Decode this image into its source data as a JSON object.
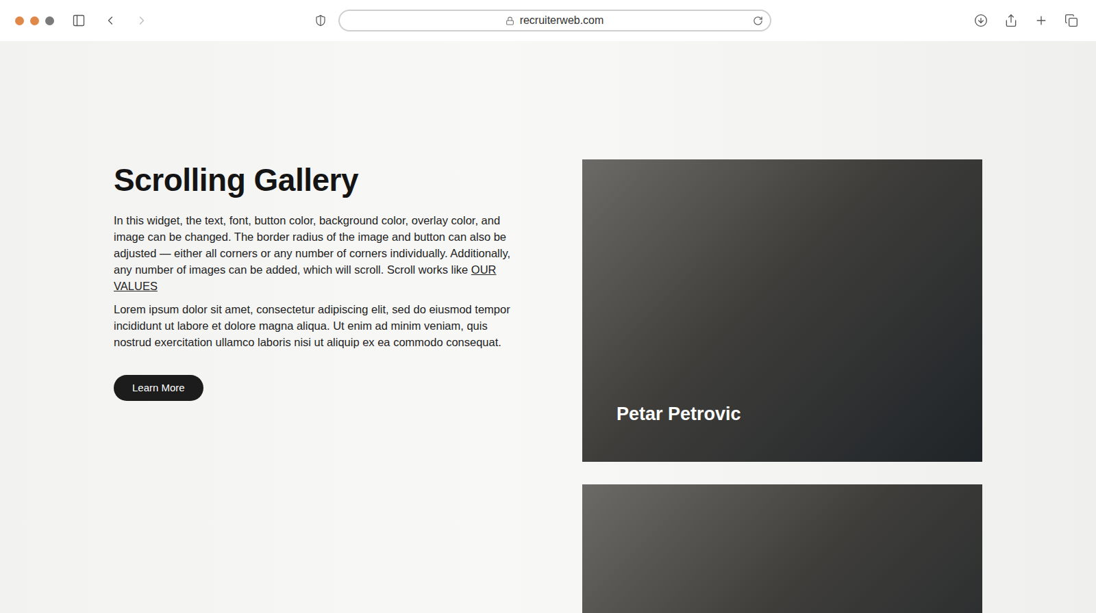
{
  "browser": {
    "url": "recruiterweb.com",
    "back_enabled": true,
    "forward_enabled": false
  },
  "section": {
    "title": "Scrolling Gallery",
    "intro": {
      "text": "In this widget, the text, font, button color, background color, overlay color, and image can be changed. The border radius of the image and button can also be adjusted — either all corners or any number of corners individually. Additionally, any number of images can be added, which will scroll. Scroll works like ",
      "link": "OUR VALUES"
    },
    "body": "Lorem ipsum dolor sit amet, consectetur adipiscing elit, sed do eiusmod tempor incididunt ut labore et dolore magna aliqua. Ut enim ad minim veniam, quis nostrud exercitation ullamco laboris nisi ut aliquip ex ea commodo consequat.",
    "button": "Learn More"
  },
  "gallery": [
    {
      "caption": "Petar Petrovic"
    },
    {
      "caption": null
    }
  ]
}
